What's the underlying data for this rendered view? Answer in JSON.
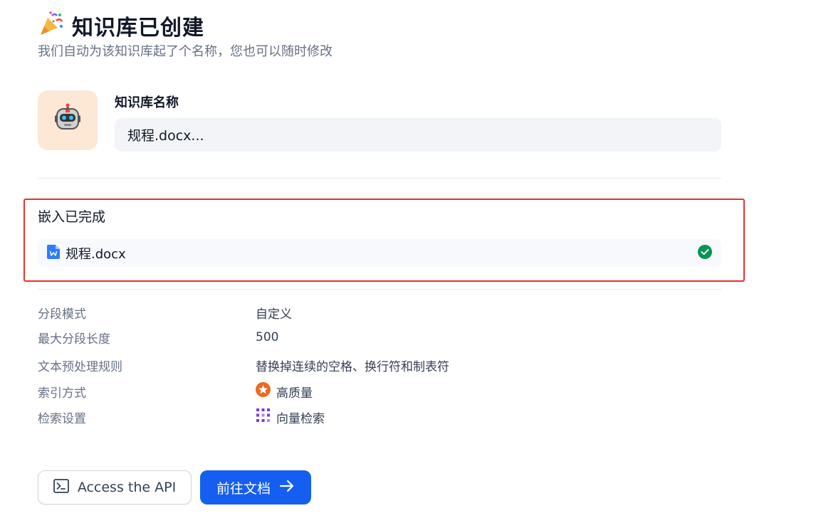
{
  "header": {
    "title": "知识库已创建",
    "subtitle": "我们自动为该知识库起了个名称，您也可以随时修改",
    "title_icon": "party-popper-icon"
  },
  "name_section": {
    "label": "知识库名称",
    "value": "规程.docx...",
    "avatar_icon": "robot-icon",
    "avatar_bg": "#fde7d5"
  },
  "embedding": {
    "title": "嵌入已完成",
    "files": [
      {
        "name": "规程.docx",
        "file_icon": "word-file-icon",
        "status_icon": "check-circle-icon",
        "status_color": "#079455"
      }
    ]
  },
  "settings": [
    {
      "label": "分段模式",
      "value": "自定义"
    },
    {
      "label": "最大分段长度",
      "value": "500"
    },
    {
      "label": "文本预处理规则",
      "value": "替换掉连续的空格、换行符和制表符"
    },
    {
      "label": "索引方式",
      "value": "高质量",
      "icon": "high-quality-icon",
      "icon_color": "#ef6820"
    },
    {
      "label": "检索设置",
      "value": "向量检索",
      "icon": "vector-search-icon",
      "icon_color": "#7839ee"
    }
  ],
  "actions": {
    "api_button": {
      "label": "Access the API",
      "icon": "terminal-icon"
    },
    "docs_button": {
      "label": "前往文档",
      "icon": "arrow-right-icon",
      "bg": "#155eef"
    }
  },
  "colors": {
    "highlight_border": "#e5322d",
    "primary": "#155eef"
  }
}
